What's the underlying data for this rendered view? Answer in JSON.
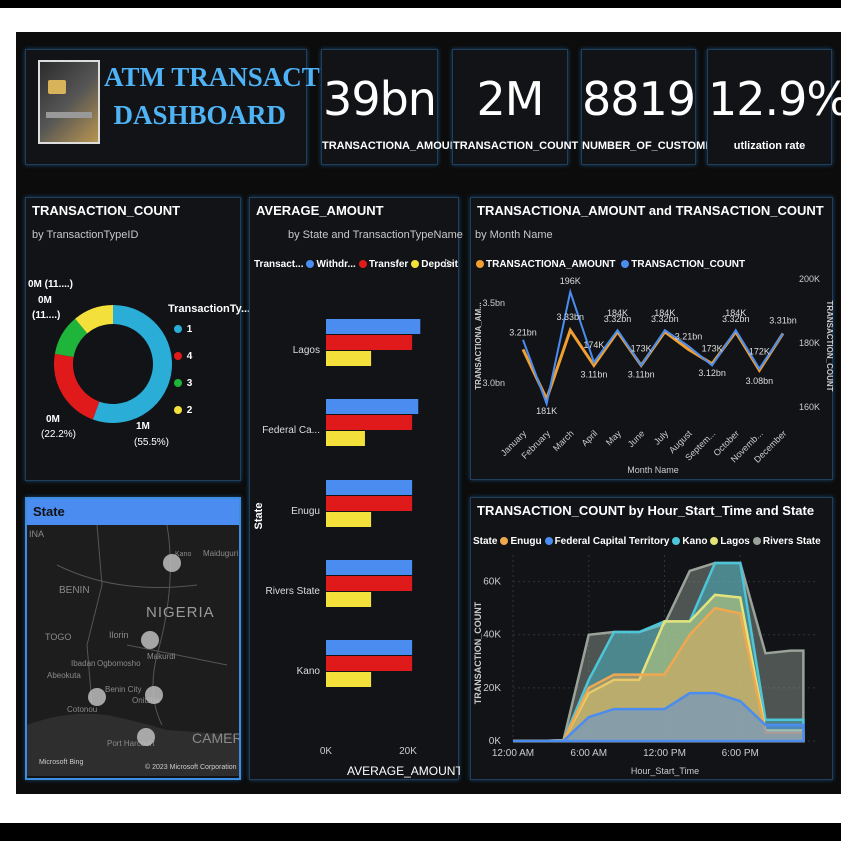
{
  "header": {
    "title_line1": "ATM TRANSACTION",
    "title_line2": "DASHBOARD"
  },
  "colors": {
    "withdrawal": "#4a8cf0",
    "transfer": "#e01a1a",
    "deposit": "#f3e03a",
    "amount_line": "#f0a030",
    "count_line": "#4a8cf0",
    "panel_border": "#1f3f5c"
  },
  "kpis": [
    {
      "value": "39bn",
      "label": "TRANSACTIONA_AMOUNT"
    },
    {
      "value": "2M",
      "label": "TRANSACTION_COUNT"
    },
    {
      "value": "8819",
      "label": "NUMBER_OF_CUSTOMERS"
    },
    {
      "value": "12.9%",
      "label": "utlization rate"
    }
  ],
  "donut": {
    "title": "TRANSACTION_COUNT",
    "subtitle": "by TransactionTypeID",
    "legend_title": "TransactionTy...",
    "labels": {
      "top": "0M (11....)",
      "left_a": "0M",
      "left_b": "(11....)",
      "bottom_left_a": "0M",
      "bottom_left_b": "(22.2%)",
      "bottom_right_a": "1M",
      "bottom_right_b": "(55.5%)"
    }
  },
  "bar_panel": {
    "title": "AVERAGE_AMOUNT",
    "subtitle": "by State and TransactionTypeName",
    "legend_title": "Transact...",
    "legend": [
      "Withdr...",
      "Transfer",
      "Deposit"
    ],
    "ylabel": "State",
    "xlabel": "AVERAGE_AMOUNT",
    "ticks": [
      "0K",
      "20K"
    ]
  },
  "line_panel": {
    "title": "TRANSACTIONA_AMOUNT and TRANSACTION_COUNT",
    "subtitle": "by Month Name",
    "legend": [
      "TRANSACTIONA_AMOUNT",
      "TRANSACTION_COUNT"
    ],
    "ylabel_left": "TRANSACTIONA_AM...",
    "ylabel_right": "TRANSACTION_COUNT",
    "xlabel": "Month Name",
    "left_ticks": [
      "3.5bn",
      "3.0bn"
    ],
    "right_ticks": [
      "200K",
      "180K",
      "160K"
    ],
    "amount_labels": [
      "3.21bn",
      "3.33bn",
      "3.11bn",
      "3.32bn",
      "3.11bn",
      "3.32bn",
      "3.21bn",
      "3.12bn",
      "3.32bn",
      "3.08bn",
      "3.31bn"
    ],
    "count_labels": [
      "181K",
      "196K",
      "174K",
      "184K",
      "173K",
      "184K",
      "173K",
      "184K",
      "172K"
    ]
  },
  "area_panel": {
    "title": "TRANSACTION_COUNT by Hour_Start_Time and State",
    "legend_title": "State",
    "legend": [
      "Enugu",
      "Federal Capital Territory",
      "Kano",
      "Lagos",
      "Rivers State"
    ],
    "ylabel": "TRANSACTION_COUNT",
    "xlabel": "Hour_Start_Time",
    "yticks": [
      "60K",
      "40K",
      "20K",
      "0K"
    ],
    "xticks": [
      "12:00 AM",
      "6:00 AM",
      "12:00 PM",
      "6:00 PM"
    ]
  },
  "map": {
    "title": "State",
    "country": "NIGERIA",
    "places": [
      "INA",
      "BENIN",
      "TOGO",
      "Ilorin",
      "Ibadan",
      "Ogbomosho",
      "Abeokuta",
      "Makurdi",
      "Benin City",
      "Onitsha",
      "Port Harcourt",
      "Cotonou",
      "Kano",
      "Maiduguri",
      "CAMERO"
    ],
    "footer_left": "Microsoft Bing",
    "footer_right": "© 2023 Microsoft Corporation"
  },
  "chart_data": [
    {
      "type": "pie",
      "title": "TRANSACTION_COUNT",
      "subtitle": "by TransactionTypeID",
      "categories": [
        "1",
        "4",
        "3",
        "2"
      ],
      "values": [
        1.0,
        0.4,
        0.2,
        0.2
      ],
      "percent": [
        55.5,
        22.2,
        11.1,
        11.1
      ],
      "colors": [
        "#2aaed8",
        "#e01a1a",
        "#1fb53a",
        "#f3e03a"
      ]
    },
    {
      "type": "bar",
      "title": "AVERAGE_AMOUNT",
      "subtitle": "by State and TransactionTypeName",
      "categories": [
        "Lagos",
        "Federal Ca...",
        "Enugu",
        "Rivers State",
        "Kano"
      ],
      "series": [
        {
          "name": "Withdr...",
          "values": [
            23000,
            22500,
            21000,
            21000,
            21000
          ]
        },
        {
          "name": "Transfer",
          "values": [
            21000,
            21000,
            21000,
            21000,
            21000
          ]
        },
        {
          "name": "Deposit",
          "values": [
            11000,
            9500,
            11000,
            11000,
            11000
          ]
        }
      ],
      "xlim": [
        0,
        25000
      ],
      "xlabel": "AVERAGE_AMOUNT",
      "ylabel": "State"
    },
    {
      "type": "line",
      "title": "TRANSACTIONA_AMOUNT and TRANSACTION_COUNT",
      "subtitle": "by Month Name",
      "categories": [
        "January",
        "February",
        "March",
        "April",
        "May",
        "June",
        "July",
        "August",
        "Septem...",
        "October",
        "Novemb...",
        "December"
      ],
      "series": [
        {
          "name": "TRANSACTIONA_AMOUNT",
          "values": [
            3.21,
            2.9,
            3.33,
            3.11,
            3.32,
            3.11,
            3.32,
            3.21,
            3.12,
            3.32,
            3.08,
            3.31
          ],
          "ylim": [
            2.75,
            3.75
          ]
        },
        {
          "name": "TRANSACTION_COUNT",
          "values": [
            181000,
            161000,
            196000,
            174000,
            184000,
            173000,
            184000,
            179000,
            173000,
            184000,
            172000,
            183000
          ],
          "ylim": [
            155000,
            205000
          ]
        }
      ],
      "xlabel": "Month Name"
    },
    {
      "type": "area",
      "title": "TRANSACTION_COUNT by Hour_Start_Time and State",
      "x": [
        0,
        2,
        4,
        6,
        8,
        10,
        12,
        14,
        16,
        18,
        20,
        22,
        23
      ],
      "series": [
        {
          "name": "Rivers State",
          "values": [
            0,
            0,
            300,
            40000,
            41000,
            41000,
            44000,
            64000,
            67000,
            67000,
            33000,
            34000,
            34000
          ]
        },
        {
          "name": "Kano",
          "values": [
            0,
            0,
            300,
            23000,
            41000,
            41000,
            45000,
            45000,
            67000,
            67000,
            8000,
            8000,
            8000
          ]
        },
        {
          "name": "Lagos",
          "values": [
            0,
            0,
            200,
            18000,
            23000,
            23000,
            45000,
            45000,
            55000,
            54000,
            4000,
            4000,
            4000
          ]
        },
        {
          "name": "Enugu",
          "values": [
            0,
            0,
            200,
            20000,
            25000,
            25000,
            25000,
            40000,
            50000,
            48000,
            3000,
            3000,
            3000
          ]
        },
        {
          "name": "Federal Capital Territory",
          "values": [
            0,
            0,
            100,
            9000,
            12000,
            12000,
            12000,
            18000,
            18000,
            15000,
            6000,
            6000,
            6000
          ]
        }
      ],
      "colors": [
        "#9aa39a",
        "#4cc6d8",
        "#e3e37a",
        "#f0a850",
        "#4a8cf0"
      ],
      "ylim": [
        0,
        70000
      ],
      "xlabel": "Hour_Start_Time",
      "ylabel": "TRANSACTION_COUNT"
    }
  ]
}
